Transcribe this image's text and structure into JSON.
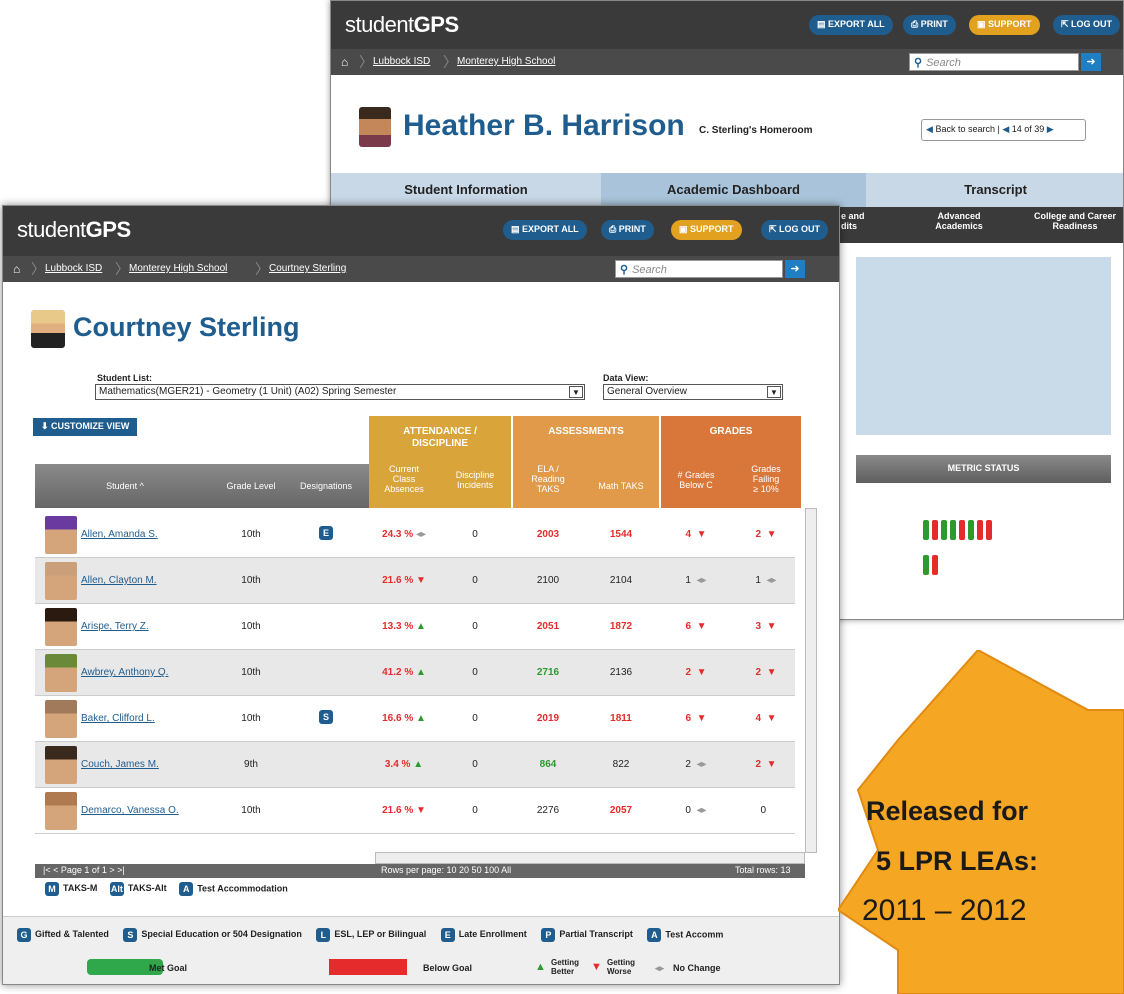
{
  "back": {
    "logo": {
      "pre": "student",
      "post": "GPS"
    },
    "buttons": {
      "export": "EXPORT ALL",
      "print": "PRINT",
      "support": "SUPPORT",
      "logout": "LOG OUT"
    },
    "crumbs": [
      "Lubbock ISD",
      "Monterey High School"
    ],
    "search_placeholder": "Search",
    "student_name": "Heather B. Harrison",
    "homeroom": "C. Sterling's Homeroom",
    "back_to_search": "Back to search",
    "pager": "14 of 39",
    "tabs": [
      "Student Information",
      "Academic Dashboard",
      "Transcript"
    ],
    "subtabs": [
      "e and\ndits",
      "Advanced\nAcademics",
      "College and Career\nReadiness"
    ],
    "metric_status": "METRIC STATUS"
  },
  "front": {
    "logo": {
      "pre": "student",
      "post": "GPS"
    },
    "buttons": {
      "export": "EXPORT ALL",
      "print": "PRINT",
      "support": "SUPPORT",
      "logout": "LOG OUT"
    },
    "crumbs": [
      "Lubbock ISD",
      "Monterey High School",
      "Courtney Sterling"
    ],
    "search_placeholder": "Search",
    "teacher_name": "Courtney Sterling",
    "student_list_label": "Student List:",
    "student_list_value": "Mathematics(MGER21) - Geometry (1 Unit) (A02) Spring Semester",
    "data_view_label": "Data View:",
    "data_view_value": "General Overview",
    "customize": "CUSTOMIZE VIEW",
    "groups": [
      "ATTENDANCE /\nDISCIPLINE",
      "ASSESSMENTS",
      "GRADES"
    ],
    "columns": [
      "Student ^",
      "Grade Level",
      "Designations",
      "Current\nClass\nAbsences",
      "Discipline\nIncidents",
      "ELA /\nReading\nTAKS",
      "Math TAKS",
      "# Grades\nBelow C",
      "Grades\nFailing\n≥ 10%"
    ],
    "rows": [
      {
        "name": "Allen, Amanda S.",
        "grade": "10th",
        "des": "E",
        "abs": "24.3 %",
        "absT": "nc",
        "disc": "0",
        "ela": "2003",
        "elaC": "red",
        "math": "1544",
        "mathC": "red",
        "bc": "4",
        "bcT": "down",
        "gf": "2",
        "gfT": "down"
      },
      {
        "name": "Allen, Clayton M.",
        "grade": "10th",
        "des": "",
        "abs": "21.6 %",
        "absT": "down",
        "disc": "0",
        "ela": "2100",
        "elaC": "",
        "math": "2104",
        "mathC": "",
        "bc": "1",
        "bcT": "nc",
        "gf": "1",
        "gfT": "nc"
      },
      {
        "name": "Arispe, Terry Z.",
        "grade": "10th",
        "des": "",
        "abs": "13.3 %",
        "absT": "up",
        "disc": "0",
        "ela": "2051",
        "elaC": "red",
        "math": "1872",
        "mathC": "red",
        "bc": "6",
        "bcT": "down",
        "gf": "3",
        "gfT": "down"
      },
      {
        "name": "Awbrey, Anthony Q.",
        "grade": "10th",
        "des": "",
        "abs": "41.2 %",
        "absT": "up",
        "disc": "0",
        "ela": "2716",
        "elaC": "green",
        "math": "2136",
        "mathC": "",
        "bc": "2",
        "bcT": "down",
        "gf": "2",
        "gfT": "down"
      },
      {
        "name": "Baker, Clifford L.",
        "grade": "10th",
        "des": "S",
        "abs": "16.6 %",
        "absT": "up",
        "disc": "0",
        "ela": "2019",
        "elaC": "red",
        "math": "1811",
        "mathC": "red",
        "bc": "6",
        "bcT": "down",
        "gf": "4",
        "gfT": "down"
      },
      {
        "name": "Couch, James M.",
        "grade": "9th",
        "des": "",
        "abs": "3.4 %",
        "absT": "up",
        "disc": "0",
        "ela": "864",
        "elaC": "green",
        "math": "822",
        "mathC": "",
        "bc": "2",
        "bcT": "nc",
        "gf": "2",
        "gfT": "down"
      },
      {
        "name": "Demarco, Vanessa O.",
        "grade": "10th",
        "des": "",
        "abs": "21.6 %",
        "absT": "down",
        "disc": "0",
        "ela": "2276",
        "elaC": "",
        "math": "2057",
        "mathC": "red",
        "bc": "0",
        "bcT": "nc",
        "gf": "0",
        "gfT": ""
      }
    ],
    "page_info": "|< < Page 1 of 1 > >|",
    "rows_per_page": "Rows per page: 10 20 50 100 All",
    "total_rows": "Total rows: 13",
    "legend_small": [
      {
        "b": "M",
        "t": "TAKS-M"
      },
      {
        "b": "Alt",
        "t": "TAKS-Alt"
      },
      {
        "b": "A",
        "t": "Test Accommodation"
      }
    ],
    "legend_main": [
      {
        "b": "G",
        "t": "Gifted & Talented"
      },
      {
        "b": "S",
        "t": "Special Education or 504 Designation"
      },
      {
        "b": "L",
        "t": "ESL, LEP or Bilingual"
      },
      {
        "b": "E",
        "t": "Late Enrollment"
      },
      {
        "b": "P",
        "t": "Partial Transcript"
      },
      {
        "b": "A",
        "t": "Test Accomm"
      }
    ],
    "key": {
      "met": "Met Goal",
      "below": "Below Goal",
      "better": "Getting\nBetter",
      "worse": "Getting\nWorse",
      "nochange": "No Change"
    }
  },
  "banner": {
    "line1": "Released for",
    "line2": "5 LPR LEAs:",
    "line3": "2011 – 2012"
  },
  "colors": {
    "dark": "#3a3a3a",
    "blue": "#1f5d8f",
    "attendance": "#d9a43a",
    "assessments": "#e09a4a",
    "grades": "#d9773a",
    "banner": "#f5a623",
    "green": "#2d9a2d",
    "red": "#e52b2b"
  }
}
